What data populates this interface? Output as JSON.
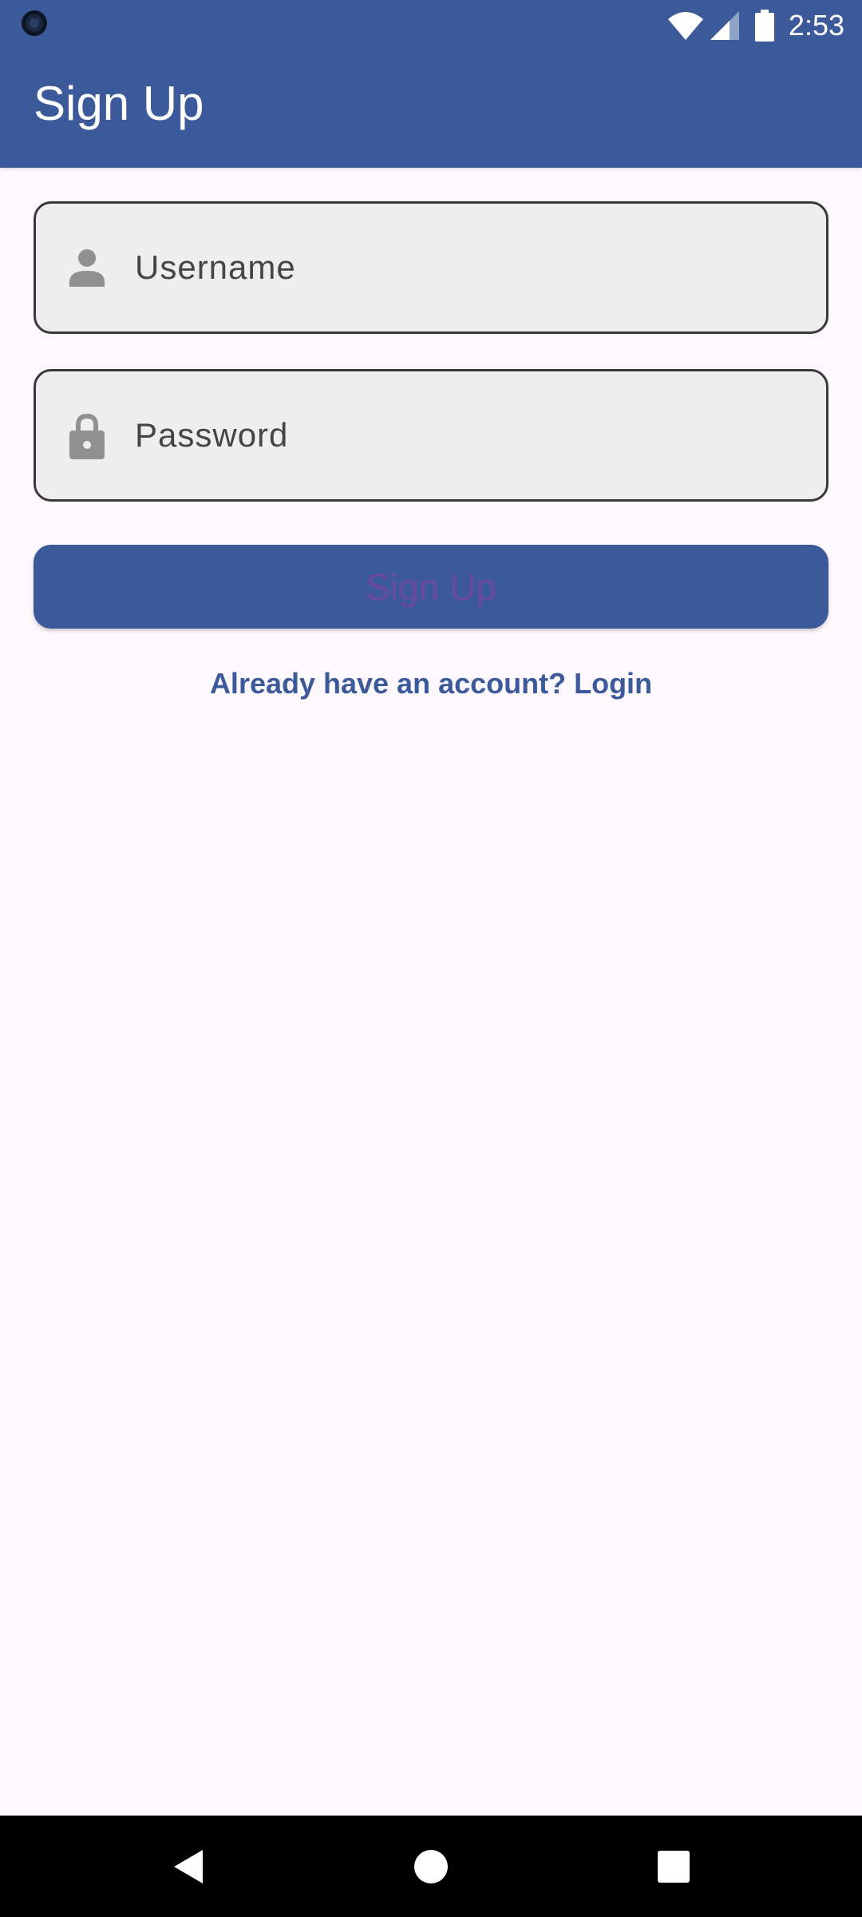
{
  "status_bar": {
    "time": "2:53",
    "icons": [
      "camera-dot-icon",
      "wifi-icon",
      "signal-icon",
      "battery-icon"
    ]
  },
  "app_bar": {
    "title": "Sign Up"
  },
  "form": {
    "username": {
      "placeholder": "Username",
      "value": "",
      "icon": "person-icon"
    },
    "password": {
      "placeholder": "Password",
      "value": "",
      "icon": "lock-icon"
    },
    "submit_label": "Sign Up",
    "login_link": "Already have an account? Login"
  },
  "nav_bar": {
    "icons": [
      "back-icon",
      "home-icon",
      "recents-icon"
    ]
  },
  "colors": {
    "primary": "#3c5a9a",
    "background": "#fdf8fd",
    "field_fill": "#eeeeee",
    "button_text": "#6a4aa0"
  }
}
